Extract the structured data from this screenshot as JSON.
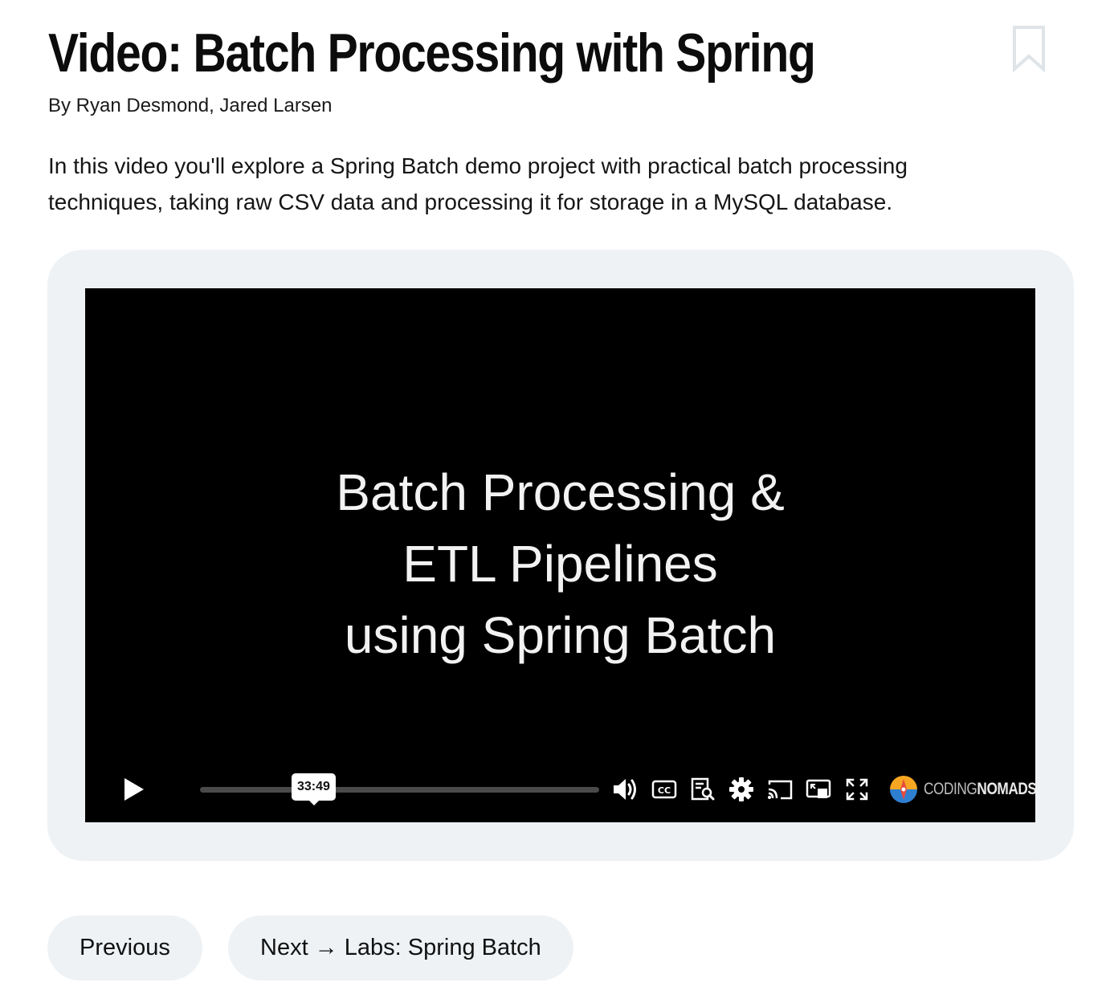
{
  "page": {
    "title": "Video: Batch Processing with Spring",
    "authors": "By Ryan Desmond, Jared Larsen",
    "description": "In this video you'll explore a Spring Batch demo project with practical batch processing techniques, taking raw CSV data and processing it for storage in a MySQL database."
  },
  "video": {
    "slide_lines": [
      "Batch Processing &",
      "ETL Pipelines",
      "using Spring Batch"
    ],
    "duration_tooltip": "33:49",
    "progress_fraction": 0,
    "controls": {
      "play": "play-icon",
      "volume": "volume-icon",
      "captions": "cc-icon",
      "transcript": "transcript-search-icon",
      "settings": "gear-icon",
      "cast": "cast-icon",
      "pip": "picture-in-picture-icon",
      "fullscreen": "fullscreen-icon"
    },
    "brand": {
      "prefix": "CODING",
      "suffix": "NOMADS"
    }
  },
  "nav": {
    "previous_label": "Previous",
    "next_label": "Next → Labs: Spring Batch"
  },
  "colors": {
    "frame_bg": "#eef2f5",
    "video_bg": "#000000",
    "bookmark_stroke": "#dfe4e8",
    "brand_orange": "#f6a623",
    "brand_blue": "#2f7fd1"
  }
}
